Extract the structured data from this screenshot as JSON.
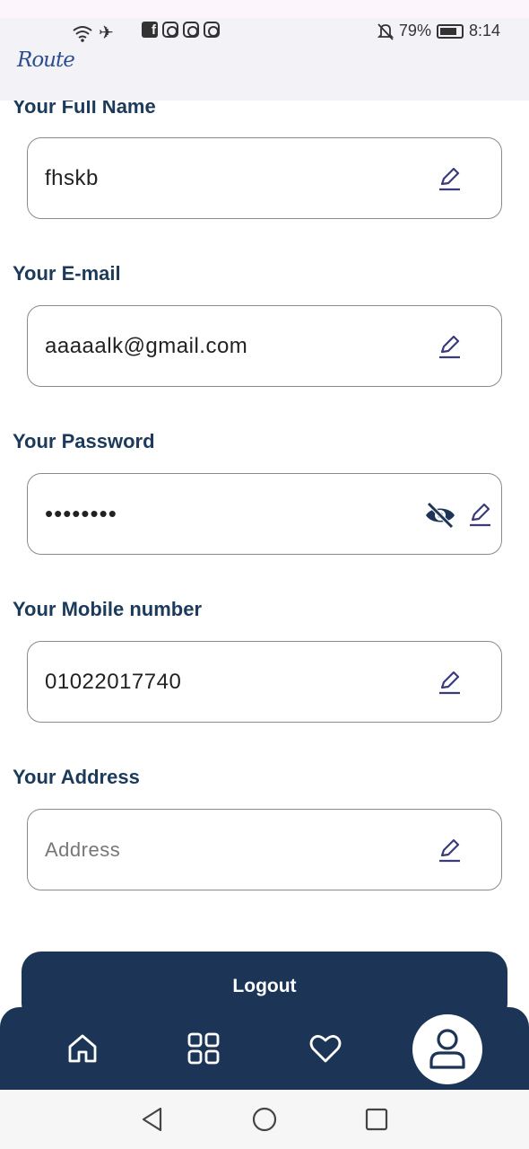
{
  "status_bar": {
    "battery": "79%",
    "time": "8:14"
  },
  "app": {
    "logo": "Route"
  },
  "fields": [
    {
      "label": "Your Full Name",
      "value": "fhskb",
      "placeholder": ""
    },
    {
      "label": "Your E-mail",
      "value": "aaaaalk@gmail.com",
      "placeholder": ""
    },
    {
      "label": "Your Password",
      "value": "••••••••",
      "placeholder": ""
    },
    {
      "label": "Your Mobile number",
      "value": "01022017740",
      "placeholder": ""
    },
    {
      "label": "Your Address",
      "value": "",
      "placeholder": "Address"
    }
  ],
  "actions": {
    "logout_label": "Logout"
  },
  "bottom_nav": {
    "items": [
      "home-icon",
      "categories-icon",
      "favorites-icon",
      "profile-icon"
    ],
    "active": "profile-icon"
  },
  "colors": {
    "primary": "#1c3557",
    "label": "#1c3a5a",
    "icon_purple": "#3b3a7a"
  }
}
